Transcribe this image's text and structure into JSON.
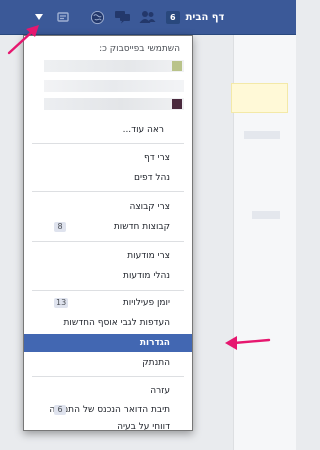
{
  "topbar": {
    "home_label": "דף הבית",
    "home_count": "6",
    "icons": [
      "caret-down-icon",
      "lock-icon",
      "globe-icon",
      "messages-icon",
      "friends-icon"
    ]
  },
  "menu": {
    "use_as_label": "השתמשי בפייסבוק כ:",
    "see_more": "ראה עוד...",
    "groups": [
      {
        "items": [
          {
            "label": "צרי דף"
          },
          {
            "label": "נהל דפים"
          }
        ]
      },
      {
        "items": [
          {
            "label": "צרי קבוצה"
          },
          {
            "label": "קבוצות חדשות",
            "badge": "8"
          }
        ]
      },
      {
        "items": [
          {
            "label": "צרי מודעות"
          },
          {
            "label": "נהלי מודעות"
          }
        ]
      },
      {
        "items": [
          {
            "label": "יומן פעילויות",
            "badge": "13"
          },
          {
            "label": "העדפות לגבי אוסף החדשות"
          },
          {
            "label": "הגדרות",
            "active": true
          },
          {
            "label": "התנתק"
          }
        ]
      },
      {
        "items": [
          {
            "label": "עזרה"
          },
          {
            "label": "תיבת הדואר הנכנס של התמיכה",
            "badge": "6"
          },
          {
            "label": "דווחי על בעיה"
          }
        ]
      }
    ]
  },
  "colors": {
    "topbar_bg": "#3b5998",
    "active_item_bg": "#4267b2",
    "annotation_arrow": "#e6176f"
  }
}
